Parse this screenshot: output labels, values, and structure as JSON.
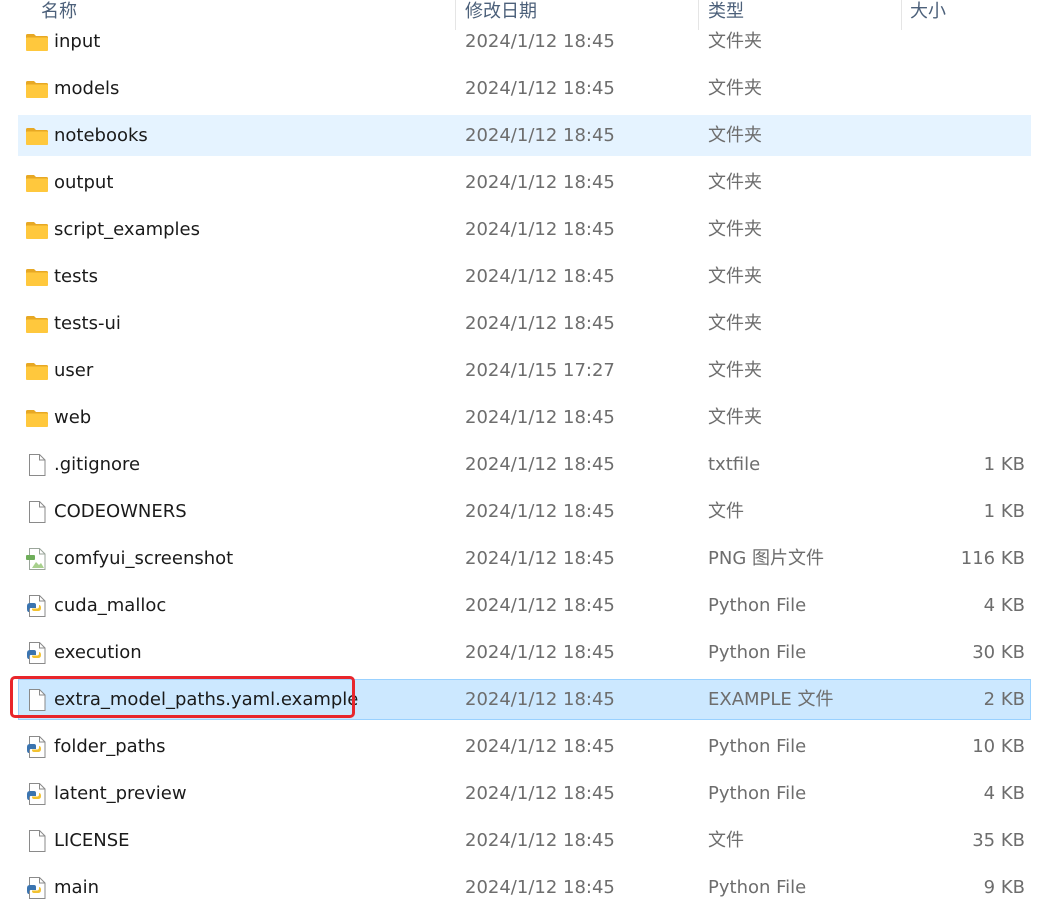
{
  "header": {
    "name": "名称",
    "date": "修改日期",
    "type": "类型",
    "size": "大小"
  },
  "files": [
    {
      "name": "input",
      "date": "2024/1/12 18:45",
      "type": "文件夹",
      "size": "",
      "icon": "folder-icon",
      "state": "normal"
    },
    {
      "name": "models",
      "date": "2024/1/12 18:45",
      "type": "文件夹",
      "size": "",
      "icon": "folder-icon",
      "state": "normal"
    },
    {
      "name": "notebooks",
      "date": "2024/1/12 18:45",
      "type": "文件夹",
      "size": "",
      "icon": "folder-icon",
      "state": "hover"
    },
    {
      "name": "output",
      "date": "2024/1/12 18:45",
      "type": "文件夹",
      "size": "",
      "icon": "folder-icon",
      "state": "normal"
    },
    {
      "name": "script_examples",
      "date": "2024/1/12 18:45",
      "type": "文件夹",
      "size": "",
      "icon": "folder-icon",
      "state": "normal"
    },
    {
      "name": "tests",
      "date": "2024/1/12 18:45",
      "type": "文件夹",
      "size": "",
      "icon": "folder-icon",
      "state": "normal"
    },
    {
      "name": "tests-ui",
      "date": "2024/1/12 18:45",
      "type": "文件夹",
      "size": "",
      "icon": "folder-icon",
      "state": "normal"
    },
    {
      "name": "user",
      "date": "2024/1/15 17:27",
      "type": "文件夹",
      "size": "",
      "icon": "folder-icon",
      "state": "normal"
    },
    {
      "name": "web",
      "date": "2024/1/12 18:45",
      "type": "文件夹",
      "size": "",
      "icon": "folder-icon",
      "state": "normal"
    },
    {
      "name": ".gitignore",
      "date": "2024/1/12 18:45",
      "type": "txtfile",
      "size": "1 KB",
      "icon": "blank-file-icon",
      "state": "normal"
    },
    {
      "name": "CODEOWNERS",
      "date": "2024/1/12 18:45",
      "type": "文件",
      "size": "1 KB",
      "icon": "blank-file-icon",
      "state": "normal"
    },
    {
      "name": "comfyui_screenshot",
      "date": "2024/1/12 18:45",
      "type": "PNG 图片文件",
      "size": "116 KB",
      "icon": "image-file-icon",
      "state": "normal"
    },
    {
      "name": "cuda_malloc",
      "date": "2024/1/12 18:45",
      "type": "Python File",
      "size": "4 KB",
      "icon": "python-file-icon",
      "state": "normal"
    },
    {
      "name": "execution",
      "date": "2024/1/12 18:45",
      "type": "Python File",
      "size": "30 KB",
      "icon": "python-file-icon",
      "state": "normal"
    },
    {
      "name": "extra_model_paths.yaml.example",
      "date": "2024/1/12 18:45",
      "type": "EXAMPLE 文件",
      "size": "2 KB",
      "icon": "blank-file-icon",
      "state": "selected"
    },
    {
      "name": "folder_paths",
      "date": "2024/1/12 18:45",
      "type": "Python File",
      "size": "10 KB",
      "icon": "python-file-icon",
      "state": "normal"
    },
    {
      "name": "latent_preview",
      "date": "2024/1/12 18:45",
      "type": "Python File",
      "size": "4 KB",
      "icon": "python-file-icon",
      "state": "normal"
    },
    {
      "name": "LICENSE",
      "date": "2024/1/12 18:45",
      "type": "文件",
      "size": "35 KB",
      "icon": "blank-file-icon",
      "state": "normal"
    },
    {
      "name": "main",
      "date": "2024/1/12 18:45",
      "type": "Python File",
      "size": "9 KB",
      "icon": "python-file-icon",
      "state": "normal"
    }
  ],
  "colors": {
    "hover_bg": "#e5f3ff",
    "selected_bg": "#cce8ff",
    "selected_border": "#99d1ff",
    "annotation_red": "#e8262c",
    "folder_yellow": "#ffc83d"
  }
}
